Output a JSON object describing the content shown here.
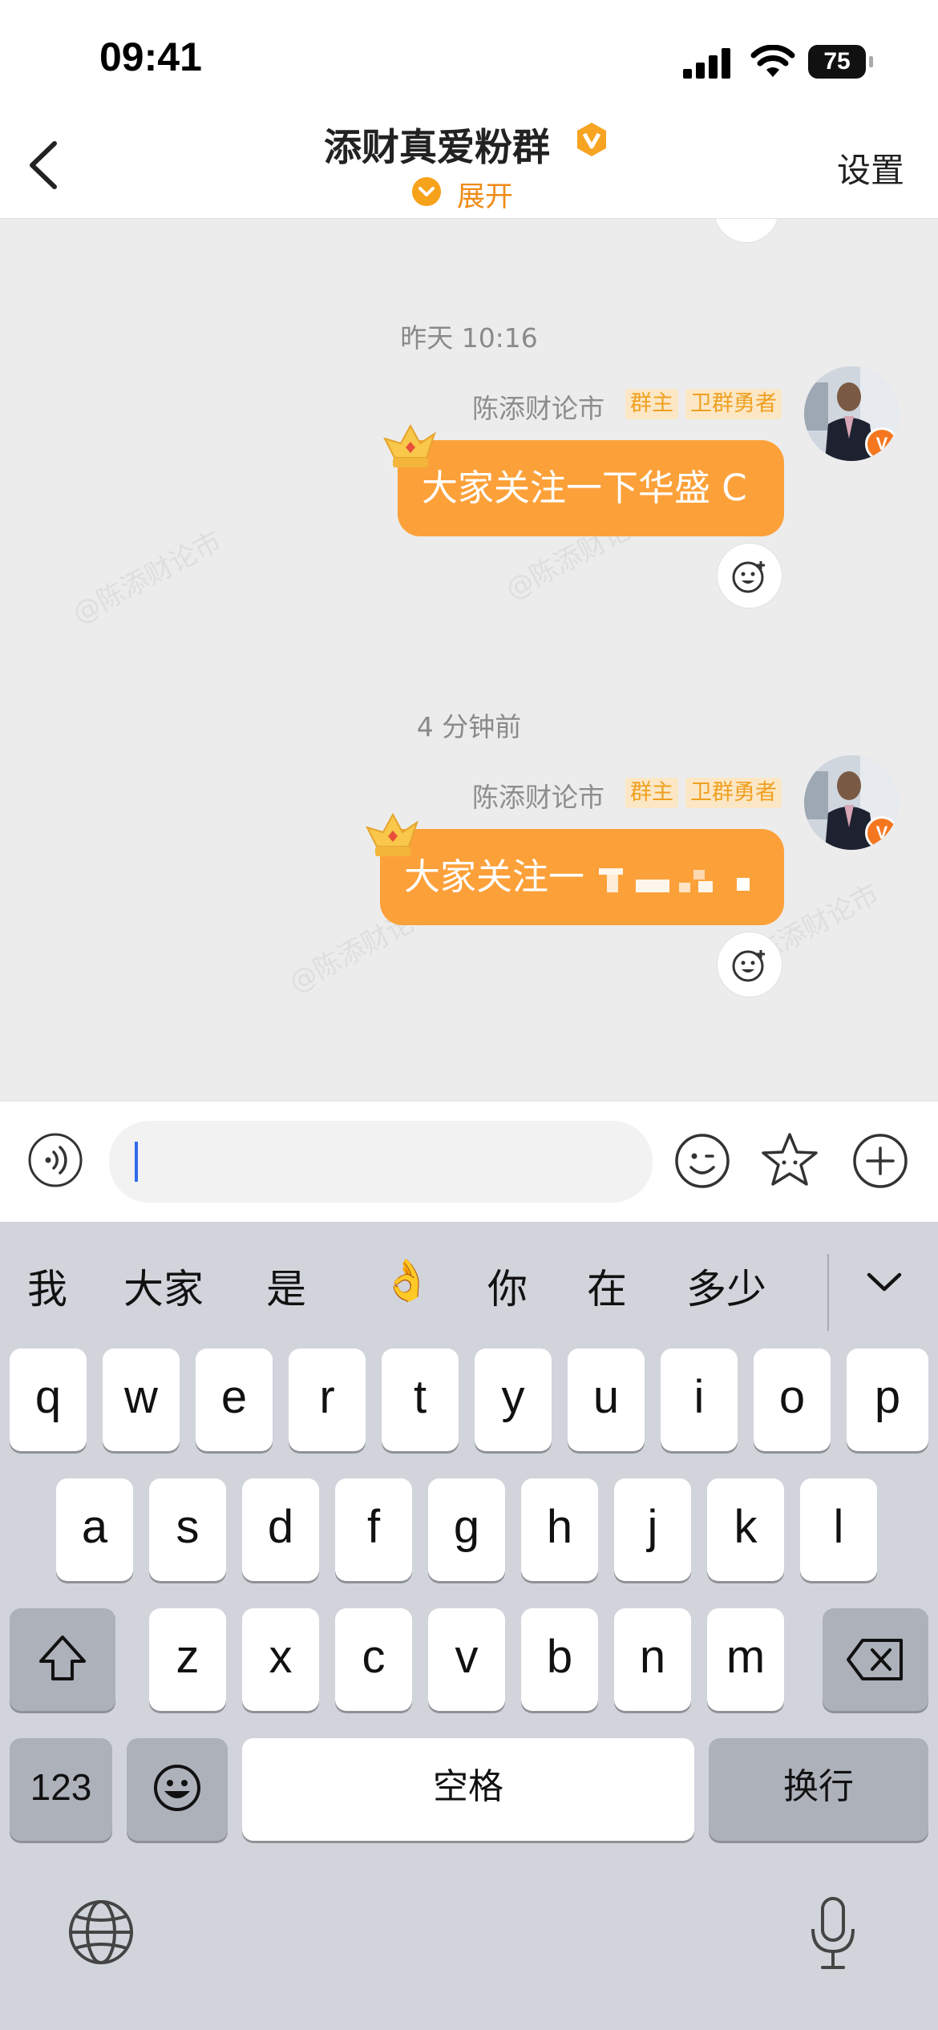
{
  "status_bar": {
    "time": "09:41",
    "battery": "75"
  },
  "header": {
    "title": "添财真爱粉群",
    "expand_label": "展开",
    "settings_label": "设置"
  },
  "watermark_text": "@陈添财论市",
  "chat": {
    "messages": [
      {
        "timestamp": "昨天 10:16",
        "sender": "陈添财论市",
        "tags": [
          "群主",
          "卫群勇者"
        ],
        "text": "大家关注一下华盛 C"
      },
      {
        "timestamp": "4 分钟前",
        "sender": "陈添财论市",
        "tags": [
          "群主",
          "卫群勇者"
        ],
        "text": "大家关注一"
      }
    ]
  },
  "input": {
    "placeholder": ""
  },
  "keyboard": {
    "suggestions": [
      "我",
      "大家",
      "是",
      "👌",
      "你",
      "在",
      "多少"
    ],
    "row1": [
      "q",
      "w",
      "e",
      "r",
      "t",
      "y",
      "u",
      "i",
      "o",
      "p"
    ],
    "row2": [
      "a",
      "s",
      "d",
      "f",
      "g",
      "h",
      "j",
      "k",
      "l"
    ],
    "row3": [
      "z",
      "x",
      "c",
      "v",
      "b",
      "n",
      "m"
    ],
    "numbers_key": "123",
    "space_key": "空格",
    "return_key": "换行"
  },
  "colors": {
    "bubble": "#fca13a",
    "accent_orange": "#ef8b15",
    "cursor": "#2f6bea",
    "keyboard_bg": "#d1d4db"
  }
}
